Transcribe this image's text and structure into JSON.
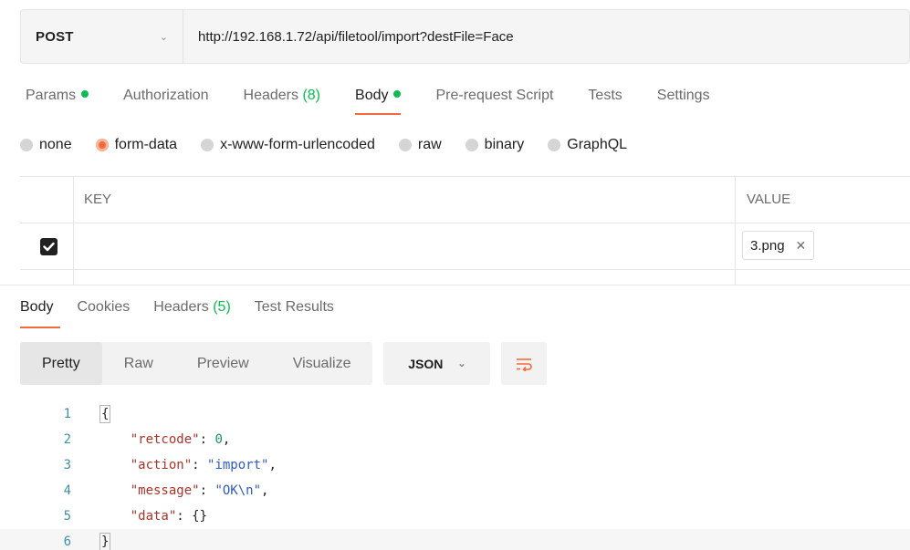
{
  "request": {
    "method": "POST",
    "url": "http://192.168.1.72/api/filetool/import?destFile=Face"
  },
  "request_tabs": [
    {
      "label": "Params",
      "count": "",
      "dot": true
    },
    {
      "label": "Authorization",
      "count": "",
      "dot": false
    },
    {
      "label": "Headers",
      "count": "(8)",
      "dot": false
    },
    {
      "label": "Body",
      "count": "",
      "dot": true,
      "active": true
    },
    {
      "label": "Pre-request Script",
      "count": "",
      "dot": false
    },
    {
      "label": "Tests",
      "count": "",
      "dot": false
    },
    {
      "label": "Settings",
      "count": "",
      "dot": false
    }
  ],
  "body_types": {
    "none": "none",
    "form_data": "form-data",
    "urlencoded": "x-www-form-urlencoded",
    "raw": "raw",
    "binary": "binary",
    "graphql": "GraphQL",
    "selected": "form-data"
  },
  "params_table": {
    "key_header": "KEY",
    "value_header": "VALUE",
    "rows": [
      {
        "checked": true,
        "key": "",
        "value_file": "3.png"
      }
    ]
  },
  "response_tabs": {
    "body": "Body",
    "cookies": "Cookies",
    "headers": "Headers",
    "headers_count": "(5)",
    "test_results": "Test Results"
  },
  "view_modes": {
    "pretty": "Pretty",
    "raw": "Raw",
    "preview": "Preview",
    "visualize": "Visualize",
    "selected": "Pretty"
  },
  "format": "JSON",
  "code_lines": {
    "1": "{",
    "2_key": "\"retcode\"",
    "2_val": "0",
    "3_key": "\"action\"",
    "3_val": "\"import\"",
    "4_key": "\"message\"",
    "4_val": "\"OK\\n\"",
    "5_key": "\"data\"",
    "5_val": "{}",
    "6": "}"
  },
  "line_numbers": [
    "1",
    "2",
    "3",
    "4",
    "5",
    "6"
  ],
  "colors": {
    "accent": "#f26b3a",
    "ok_green": "#0cbb52"
  }
}
